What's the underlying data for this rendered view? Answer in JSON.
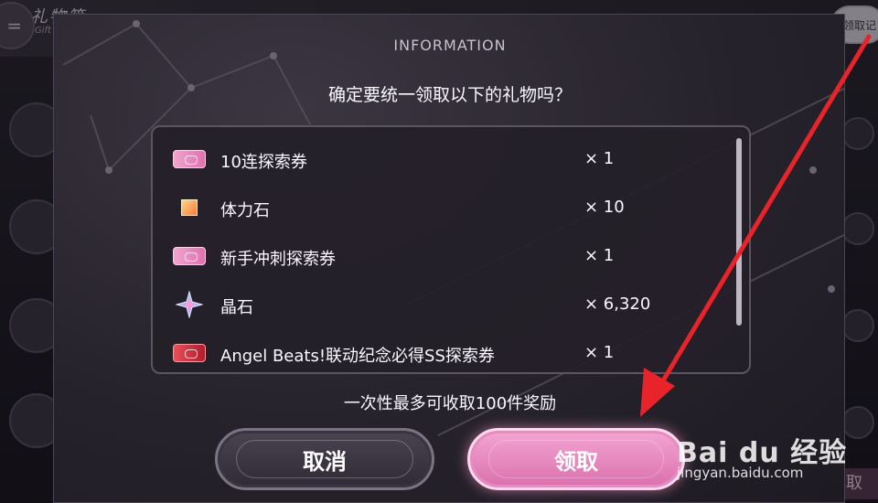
{
  "background": {
    "title": "礼物箱",
    "subtitle": "Gift",
    "history_button": "领取记",
    "claim_button": "取"
  },
  "modal": {
    "title": "INFORMATION",
    "question": "确定要统一领取以下的礼物吗？",
    "items": [
      {
        "icon": "pink-ticket-icon",
        "name": "10连探索券",
        "qty": "× 1"
      },
      {
        "icon": "stamina-stone-icon",
        "name": "体力石",
        "qty": "× 10"
      },
      {
        "icon": "pink-ticket-icon",
        "name": "新手冲刺探索券",
        "qty": "× 1"
      },
      {
        "icon": "crystal-star-icon",
        "name": "晶石",
        "qty": "× 6,320"
      },
      {
        "icon": "red-ticket-icon",
        "name": "Angel Beats!联动纪念必得SS探索券",
        "qty": "× 1"
      }
    ],
    "note": "一次性最多可收取100件奖励",
    "cancel_label": "取消",
    "confirm_label": "领取"
  },
  "watermark": {
    "main": "Bai du 经验",
    "sub": "jingyan.baidu.com"
  },
  "colors": {
    "confirm": "#e27bb6",
    "annotation_arrow": "#e8232a"
  }
}
